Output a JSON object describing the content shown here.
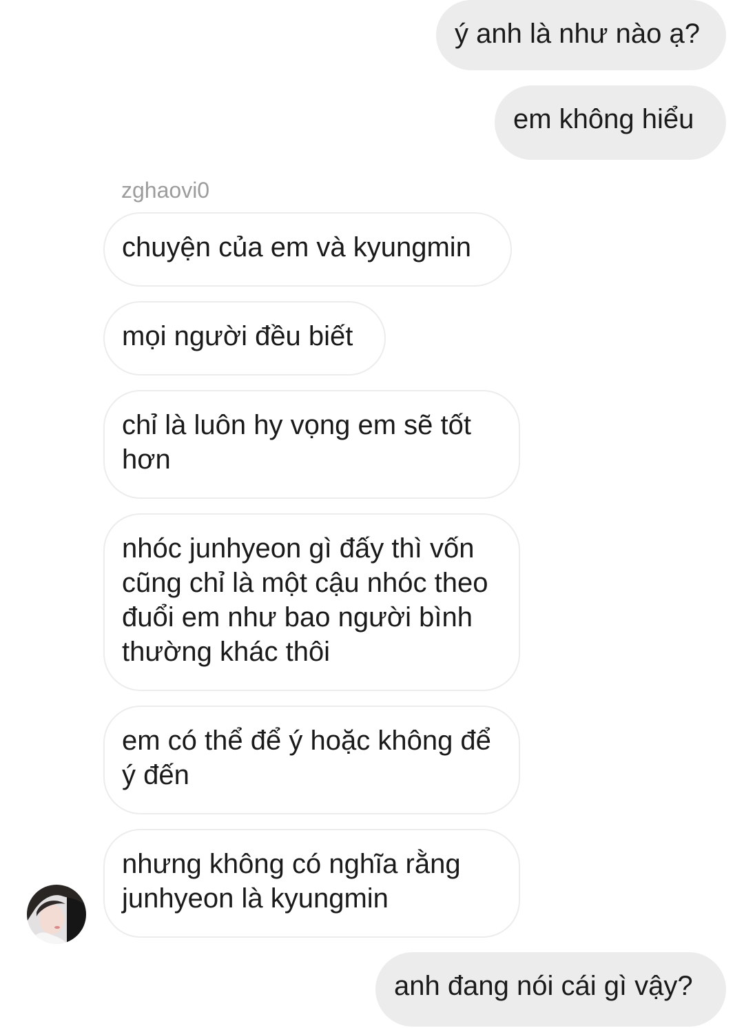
{
  "thread": {
    "sender_name": "zghaovi0",
    "messages": [
      {
        "from": "me",
        "text": "ý anh là như nào ạ?"
      },
      {
        "from": "me",
        "text": "em không hiểu"
      },
      {
        "from": "zghaovi0",
        "text": "chuyện của em và kyungmin"
      },
      {
        "from": "zghaovi0",
        "text": "mọi người đều biết"
      },
      {
        "from": "zghaovi0",
        "text": "chỉ là luôn hy vọng em sẽ tốt hơn"
      },
      {
        "from": "zghaovi0",
        "text": "nhóc junhyeon gì đấy thì vốn cũng chỉ là một cậu nhóc theo đuổi em như bao người bình thường khác thôi"
      },
      {
        "from": "zghaovi0",
        "text": "em có thể để ý hoặc không để ý đến"
      },
      {
        "from": "zghaovi0",
        "text": "nhưng không có nghĩa rằng junhyeon là kyungmin"
      },
      {
        "from": "me",
        "text": "anh đang nói cái gì vậy?"
      }
    ]
  },
  "colors": {
    "sent_bubble": "#ececec",
    "received_border": "#ececec",
    "sender_name": "#9c9c9c",
    "text": "#1a1a1a"
  }
}
